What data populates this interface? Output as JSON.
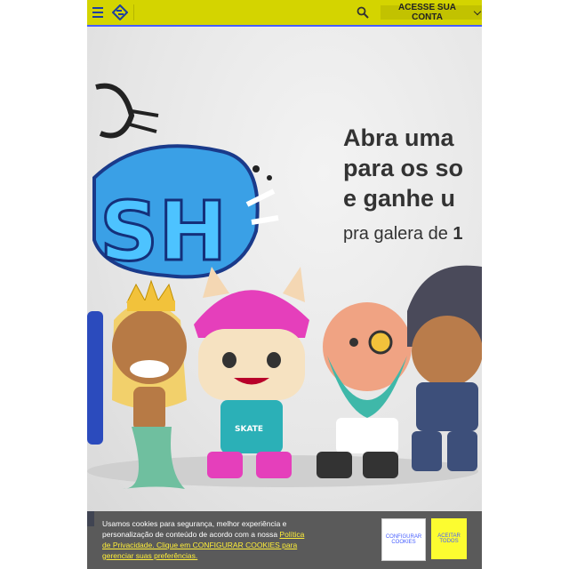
{
  "header": {
    "menu_icon": "hamburger-menu-icon",
    "logo_icon": "banco-do-brasil-logo",
    "search_icon": "search-icon",
    "account_label": "ACESSE SUA CONTA",
    "colors": {
      "bar": "#d4d400",
      "underline": "#465eff"
    }
  },
  "hero": {
    "headline_lines": [
      "Abra uma",
      "para os so",
      "e ganhe u"
    ],
    "subline_prefix": "pra galera de ",
    "subline_bold": "1",
    "illustration": "promotional banner with graffiti 'SH' lettering and five toy characters: mermaid with crown, jaguar with pink helmet and SKATE shirt, green-bearded character with monocle, dark-haired character",
    "character_shirt_text": "SKATE"
  },
  "cookie_banner": {
    "text_before": "Usamos cookies para segurança, melhor experiência e personalização de conteúdo de acordo com a nossa ",
    "link_text": "Política de Privacidade. Clique em CONFIGURAR COOKIES para gerenciar suas preferências.",
    "configure_label": "CONFIGURAR COOKIES",
    "accept_label": "ACEITAR TODOS"
  }
}
